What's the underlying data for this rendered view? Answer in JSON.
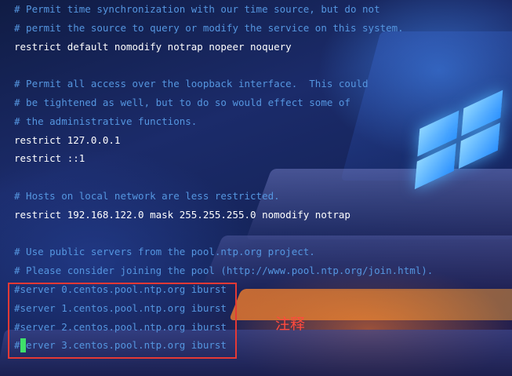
{
  "editor": {
    "lines": [
      {
        "text": "# Permit time synchronization with our time source, but do not",
        "kind": "comment"
      },
      {
        "text": "# permit the source to query or modify the service on this system.",
        "kind": "comment"
      },
      {
        "text": "restrict default nomodify notrap nopeer noquery",
        "kind": "normal"
      },
      {
        "text": "",
        "kind": "blank"
      },
      {
        "text": "# Permit all access over the loopback interface.  This could",
        "kind": "comment"
      },
      {
        "text": "# be tightened as well, but to do so would effect some of",
        "kind": "comment"
      },
      {
        "text": "# the administrative functions.",
        "kind": "comment"
      },
      {
        "text": "restrict 127.0.0.1",
        "kind": "normal"
      },
      {
        "text": "restrict ::1",
        "kind": "normal"
      },
      {
        "text": "",
        "kind": "blank"
      },
      {
        "text": "# Hosts on local network are less restricted.",
        "kind": "comment"
      },
      {
        "text": "restrict 192.168.122.0 mask 255.255.255.0 nomodify notrap",
        "kind": "normal"
      },
      {
        "text": "",
        "kind": "blank"
      },
      {
        "text": "# Use public servers from the pool.ntp.org project.",
        "kind": "comment"
      },
      {
        "text": "# Please consider joining the pool (http://www.pool.ntp.org/join.html).",
        "kind": "comment"
      },
      {
        "text": "#server 0.centos.pool.ntp.org iburst",
        "kind": "comment"
      },
      {
        "text": "#server 1.centos.pool.ntp.org iburst",
        "kind": "comment"
      },
      {
        "text": "#server 2.centos.pool.ntp.org iburst",
        "kind": "comment"
      },
      {
        "text": "#server 3.centos.pool.ntp.org iburst",
        "kind": "comment"
      }
    ]
  },
  "annotation": {
    "label": "注释"
  },
  "colors": {
    "comment": "#5596e0",
    "normal": "#ffffff",
    "highlight_border": "#e53935",
    "annotation": "#ff4a3d",
    "cursor": "#3fe06a"
  }
}
